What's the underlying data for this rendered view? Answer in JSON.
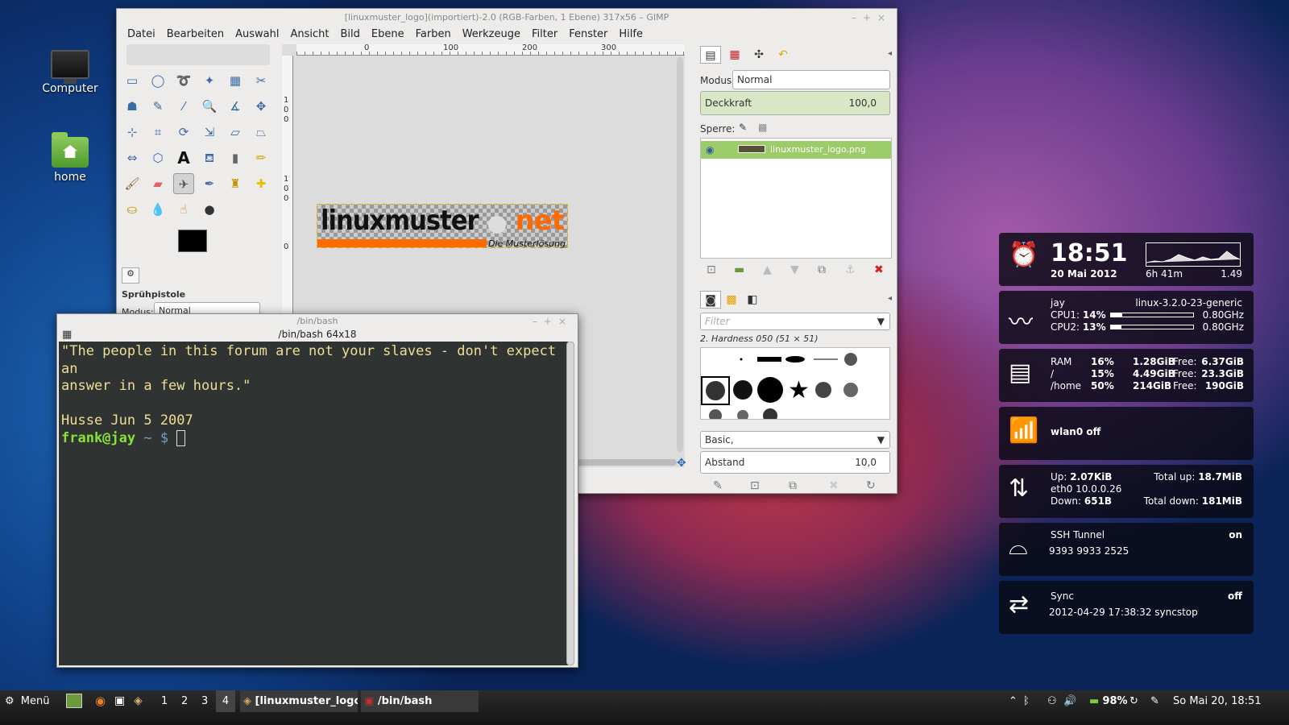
{
  "desktop": {
    "icons": [
      {
        "label": "Computer"
      },
      {
        "label": "home"
      }
    ]
  },
  "gimp": {
    "title": "[linuxmuster_logo](importiert)-2.0 (RGB-Farben, 1 Ebene) 317x56 – GIMP",
    "menu": [
      "Datei",
      "Bearbeiten",
      "Auswahl",
      "Ansicht",
      "Bild",
      "Ebene",
      "Farben",
      "Werkzeuge",
      "Filter",
      "Fenster",
      "Hilfe"
    ],
    "tool_options": {
      "title": "Sprühpistole",
      "mode_label": "Modus:",
      "mode_value": "Normal"
    },
    "ruler": {
      "h": [
        "0",
        "0",
        "100",
        "200",
        "300"
      ],
      "v": [
        "1",
        "0",
        "0",
        "1",
        "0",
        "0",
        "0"
      ]
    },
    "logo": {
      "main": "linuxmuster",
      "accent": "net",
      "sub": "Die Musterlösung"
    },
    "layers": {
      "mode_label": "Modus:",
      "mode_value": "Normal",
      "opacity_label": "Deckkraft",
      "opacity_value": "100,0",
      "lock_label": "Sperre:",
      "layer_name": "linuxmuster_logo.png"
    },
    "brushes": {
      "filter_placeholder": "Filter",
      "brush_name": "2. Hardness 050 (51 × 51)",
      "preset": "Basic,",
      "spacing_label": "Abstand",
      "spacing_value": "10,0"
    }
  },
  "terminal": {
    "title": "/bin/bash",
    "tab_title": "/bin/bash 64x18",
    "quote_line1": "\"The people in this forum are not your slaves - don't expect an",
    "quote_line2": "answer in a few hours.\"",
    "author": "Husse Jun 5 2007",
    "prompt_user": "frank@jay",
    "prompt_path": "~",
    "prompt_symbol": "$"
  },
  "conky": {
    "clock": {
      "time": "18:51",
      "date": "20 Mai 2012",
      "uptime": "6h 41m",
      "load": "1.49"
    },
    "cpu": {
      "host": "jay",
      "kernel": "linux-3.2.0-23-generic",
      "rows": [
        {
          "label": "CPU1:",
          "pct": "14%",
          "freq": "0.80GHz",
          "frac": 0.14
        },
        {
          "label": "CPU2:",
          "pct": "13%",
          "freq": "0.80GHz",
          "frac": 0.13
        }
      ]
    },
    "mem": {
      "rows": [
        {
          "name": "RAM",
          "pct": "16%",
          "used": "1.28GiB",
          "free_label": "Free:",
          "free": "6.37GiB"
        },
        {
          "name": "/",
          "pct": "15%",
          "used": "4.49GiB",
          "free_label": "Free:",
          "free": "23.3GiB"
        },
        {
          "name": "/home",
          "pct": "50%",
          "used": "214GiB",
          "free_label": "Free:",
          "free": "190GiB"
        }
      ]
    },
    "wifi": {
      "status": "wlan0 off"
    },
    "net": {
      "up_label": "Up:",
      "up": "2.07KiB",
      "iface": "eth0 10.0.0.26",
      "down_label": "Down:",
      "down": "651B",
      "total_up_label": "Total up:",
      "total_up": "18.7MiB",
      "total_down_label": "Total down:",
      "total_down": "181MiB"
    },
    "ssh": {
      "label": "SSH Tunnel",
      "status": "on",
      "ports": "9393 9933 2525"
    },
    "sync": {
      "label": "Sync",
      "status": "off",
      "detail": "2012-04-29 17:38:32 syncstop"
    }
  },
  "taskbar": {
    "menu": "Menü",
    "workspaces": [
      "1",
      "2",
      "3",
      "4"
    ],
    "windows": [
      "[linuxmuster_logo](i...",
      "/bin/bash"
    ],
    "battery": "98%",
    "clock": "So Mai 20, 18:51"
  }
}
